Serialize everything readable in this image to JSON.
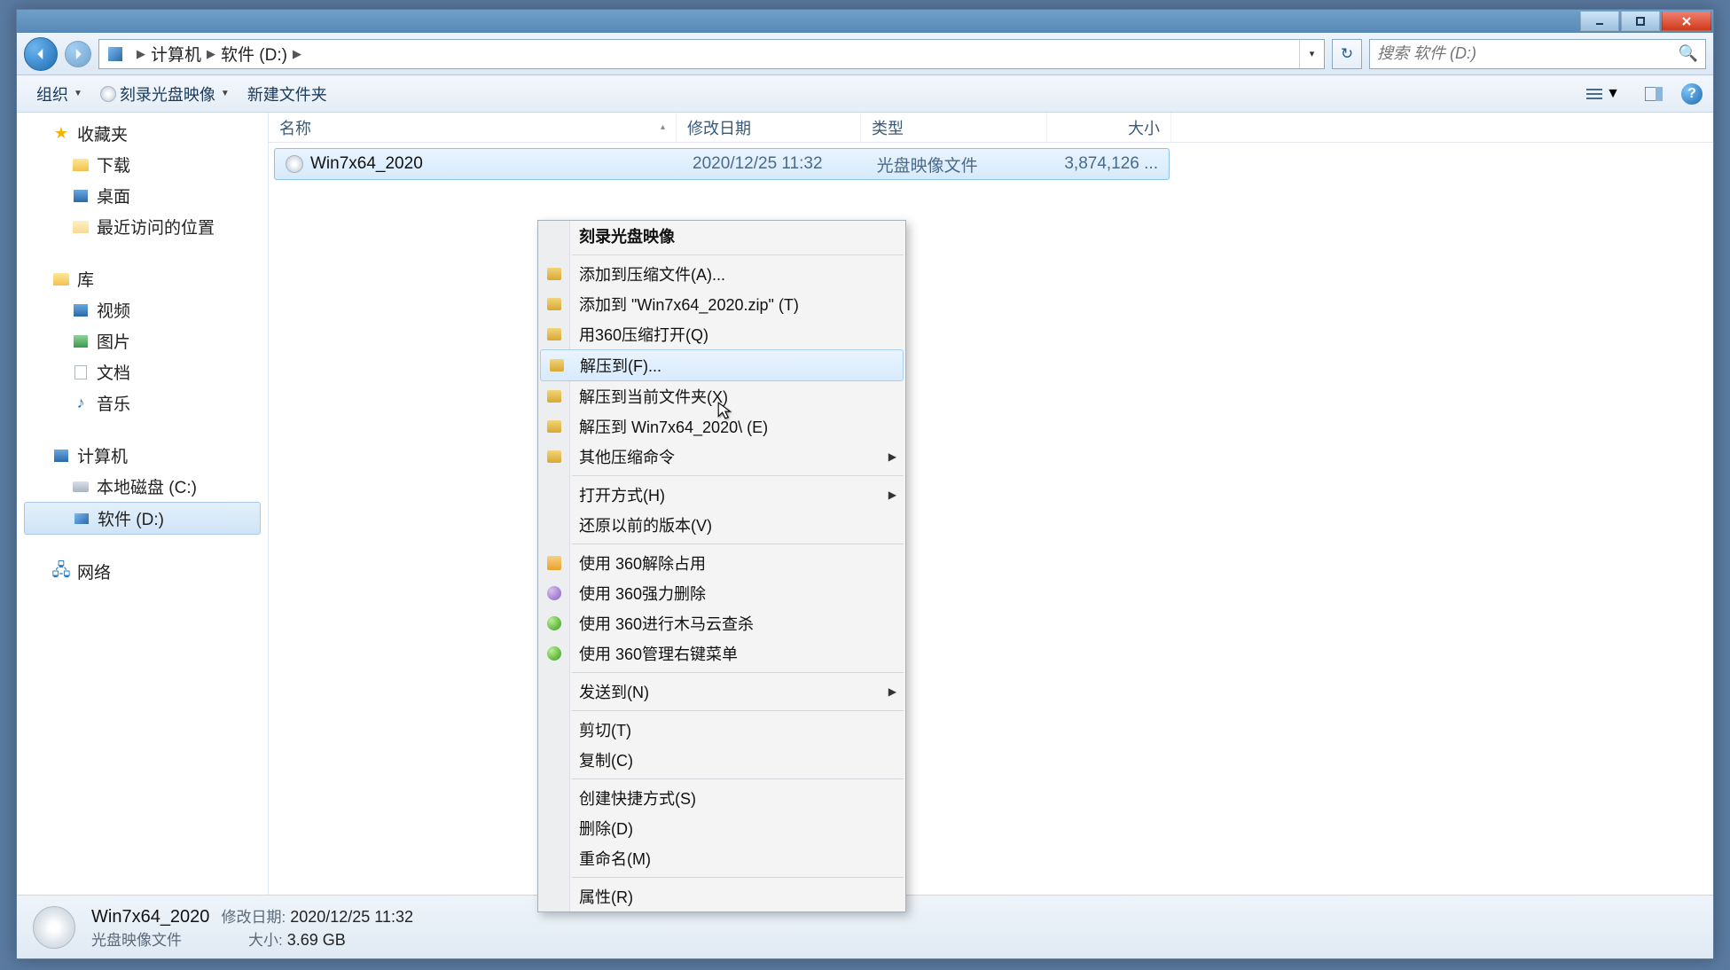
{
  "breadcrumb": {
    "root": "计算机",
    "current": "软件 (D:)"
  },
  "search": {
    "placeholder": "搜索 软件 (D:)"
  },
  "toolbar": {
    "organize": "组织",
    "burn": "刻录光盘映像",
    "newfolder": "新建文件夹"
  },
  "columns": {
    "name": "名称",
    "date": "修改日期",
    "type": "类型",
    "size": "大小"
  },
  "file": {
    "name": "Win7x64_2020",
    "date": "2020/12/25 11:32",
    "type": "光盘映像文件",
    "size": "3,874,126 ..."
  },
  "sidebar": {
    "favorites": "收藏夹",
    "fav_items": [
      "下载",
      "桌面",
      "最近访问的位置"
    ],
    "libraries": "库",
    "lib_items": [
      "视频",
      "图片",
      "文档",
      "音乐"
    ],
    "computer": "计算机",
    "comp_items": [
      "本地磁盘 (C:)",
      "软件 (D:)"
    ],
    "network": "网络"
  },
  "context": {
    "burn": "刻录光盘映像",
    "add_archive": "添加到压缩文件(A)...",
    "add_zip": "添加到 \"Win7x64_2020.zip\" (T)",
    "open_360zip": "用360压缩打开(Q)",
    "extract_to": "解压到(F)...",
    "extract_here": "解压到当前文件夹(X)",
    "extract_named": "解压到 Win7x64_2020\\ (E)",
    "other_zip": "其他压缩命令",
    "open_with": "打开方式(H)",
    "restore_prev": "还原以前的版本(V)",
    "unlock360": "使用 360解除占用",
    "force_del360": "使用 360强力删除",
    "scan360": "使用 360进行木马云查杀",
    "menu360": "使用 360管理右键菜单",
    "send_to": "发送到(N)",
    "cut": "剪切(T)",
    "copy": "复制(C)",
    "shortcut": "创建快捷方式(S)",
    "delete": "删除(D)",
    "rename": "重命名(M)",
    "properties": "属性(R)"
  },
  "details": {
    "title": "Win7x64_2020",
    "type": "光盘映像文件",
    "date_label": "修改日期:",
    "date_val": "2020/12/25 11:32",
    "size_label": "大小:",
    "size_val": "3.69 GB"
  }
}
